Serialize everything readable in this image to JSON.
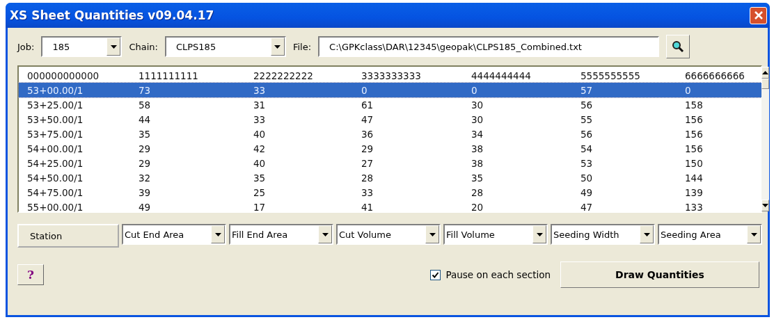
{
  "window": {
    "title": "XS Sheet Quantities v09.04.17"
  },
  "toolbar": {
    "job": {
      "label": "Job:",
      "value": "185"
    },
    "chain": {
      "label": "Chain:",
      "value": "CLPS185"
    },
    "file": {
      "label": "File:",
      "value": "C:\\GPKclass\\DAR\\12345\\geopak\\CLPS185_Combined.txt"
    }
  },
  "table": {
    "header": [
      "000000000000",
      "1111111111",
      "2222222222",
      "3333333333",
      "4444444444",
      "5555555555",
      "6666666666"
    ],
    "rows": [
      {
        "selected": true,
        "cells": [
          "53+00.00/1",
          "73",
          "33",
          "0",
          "0",
          "57",
          "0"
        ]
      },
      {
        "selected": false,
        "cells": [
          "53+25.00/1",
          "58",
          "31",
          "61",
          "30",
          "56",
          "158"
        ]
      },
      {
        "selected": false,
        "cells": [
          "53+50.00/1",
          "44",
          "33",
          "47",
          "30",
          "55",
          "156"
        ]
      },
      {
        "selected": false,
        "cells": [
          "53+75.00/1",
          "35",
          "40",
          "36",
          "34",
          "56",
          "156"
        ]
      },
      {
        "selected": false,
        "cells": [
          "54+00.00/1",
          "29",
          "42",
          "29",
          "38",
          "54",
          "156"
        ]
      },
      {
        "selected": false,
        "cells": [
          "54+25.00/1",
          "29",
          "40",
          "27",
          "38",
          "53",
          "150"
        ]
      },
      {
        "selected": false,
        "cells": [
          "54+50.00/1",
          "32",
          "35",
          "28",
          "35",
          "50",
          "144"
        ]
      },
      {
        "selected": false,
        "cells": [
          "54+75.00/1",
          "39",
          "25",
          "33",
          "28",
          "49",
          "139"
        ]
      },
      {
        "selected": false,
        "cells": [
          "55+00.00/1",
          "49",
          "17",
          "41",
          "20",
          "47",
          "133"
        ]
      }
    ]
  },
  "column_selectors": [
    {
      "kind": "label",
      "value": "Station"
    },
    {
      "kind": "dropdown",
      "value": "Cut End Area"
    },
    {
      "kind": "dropdown",
      "value": "Fill End Area"
    },
    {
      "kind": "dropdown",
      "value": "Cut Volume"
    },
    {
      "kind": "dropdown",
      "value": "Fill Volume"
    },
    {
      "kind": "dropdown",
      "value": "Seeding Width"
    },
    {
      "kind": "dropdown",
      "value": "Seeding Area"
    }
  ],
  "help_button": "?",
  "pause_checkbox": {
    "label": "Pause on each section",
    "checked": true
  },
  "draw_button": "Draw Quantities"
}
